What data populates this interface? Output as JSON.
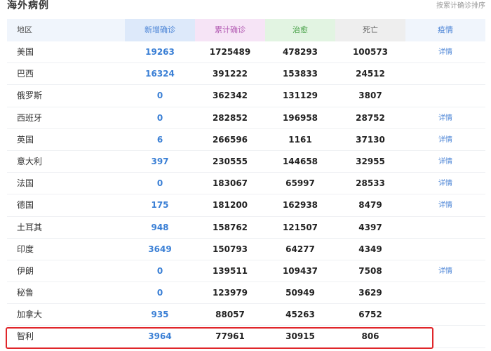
{
  "title": "海外病例",
  "sort_link": "按累计确诊排序",
  "header": {
    "region": "地区",
    "new": "新增确诊",
    "total": "累计确诊",
    "cured": "治愈",
    "dead": "死亡",
    "detail": "疫情"
  },
  "rows": [
    {
      "region": "美国",
      "new": "19263",
      "total": "1725489",
      "cured": "478293",
      "dead": "100573",
      "detail": "详情"
    },
    {
      "region": "巴西",
      "new": "16324",
      "total": "391222",
      "cured": "153833",
      "dead": "24512",
      "detail": ""
    },
    {
      "region": "俄罗斯",
      "new": "0",
      "total": "362342",
      "cured": "131129",
      "dead": "3807",
      "detail": ""
    },
    {
      "region": "西班牙",
      "new": "0",
      "total": "282852",
      "cured": "196958",
      "dead": "28752",
      "detail": "详情"
    },
    {
      "region": "英国",
      "new": "6",
      "total": "266596",
      "cured": "1161",
      "dead": "37130",
      "detail": "详情"
    },
    {
      "region": "意大利",
      "new": "397",
      "total": "230555",
      "cured": "144658",
      "dead": "32955",
      "detail": "详情"
    },
    {
      "region": "法国",
      "new": "0",
      "total": "183067",
      "cured": "65997",
      "dead": "28533",
      "detail": "详情"
    },
    {
      "region": "德国",
      "new": "175",
      "total": "181200",
      "cured": "162938",
      "dead": "8479",
      "detail": "详情"
    },
    {
      "region": "土耳其",
      "new": "948",
      "total": "158762",
      "cured": "121507",
      "dead": "4397",
      "detail": ""
    },
    {
      "region": "印度",
      "new": "3649",
      "total": "150793",
      "cured": "64277",
      "dead": "4349",
      "detail": ""
    },
    {
      "region": "伊朗",
      "new": "0",
      "total": "139511",
      "cured": "109437",
      "dead": "7508",
      "detail": "详情"
    },
    {
      "region": "秘鲁",
      "new": "0",
      "total": "123979",
      "cured": "50949",
      "dead": "3629",
      "detail": ""
    },
    {
      "region": "加拿大",
      "new": "935",
      "total": "88057",
      "cured": "45263",
      "dead": "6752",
      "detail": ""
    },
    {
      "region": "智利",
      "new": "3964",
      "total": "77961",
      "cured": "30915",
      "dead": "806",
      "detail": ""
    }
  ],
  "colors": {
    "highlight_border": "#e0262a",
    "new_header_bg": "#dde9fa",
    "total_header_bg": "#f6e4f6",
    "cured_header_bg": "#e2f4e2",
    "dead_header_bg": "#eeeeee",
    "link": "#4b84d6"
  }
}
